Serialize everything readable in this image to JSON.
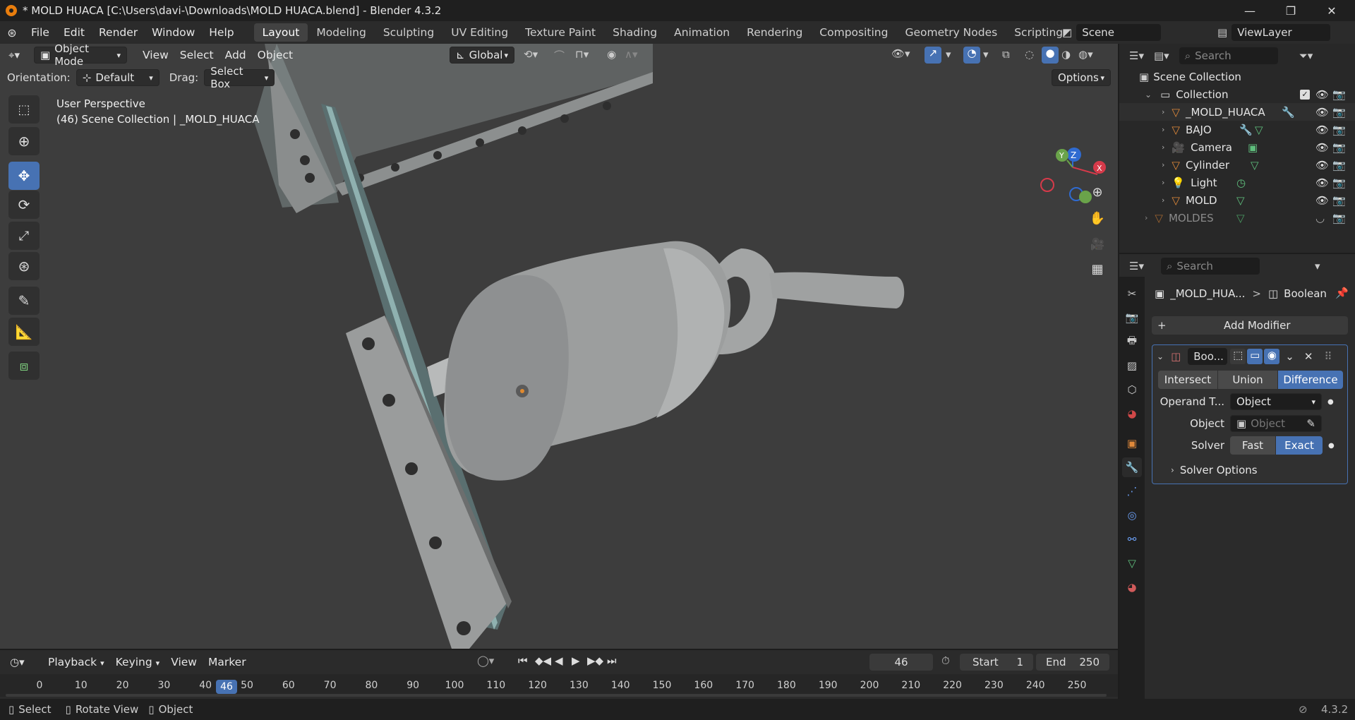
{
  "window": {
    "title": "* MOLD HUACA [C:\\Users\\davi-\\Downloads\\MOLD HUACA.blend] - Blender 4.3.2"
  },
  "menu": [
    "File",
    "Edit",
    "Render",
    "Window",
    "Help"
  ],
  "workspaces": [
    "Layout",
    "Modeling",
    "Sculpting",
    "UV Editing",
    "Texture Paint",
    "Shading",
    "Animation",
    "Rendering",
    "Compositing",
    "Geometry Nodes",
    "Scripting"
  ],
  "scene": {
    "name": "Scene",
    "view_layer": "ViewLayer"
  },
  "viewport": {
    "mode": "Object Mode",
    "menus": [
      "View",
      "Select",
      "Add",
      "Object"
    ],
    "transform_orientation": "Global",
    "orientation_label": "Orientation:",
    "orientation_value": "Default",
    "drag_label": "Drag:",
    "drag_value": "Select Box",
    "options_label": "Options",
    "overlay_line1": "User Perspective",
    "overlay_line2": "(46) Scene Collection | _MOLD_HUACA",
    "gizmo": {
      "x": "X",
      "y": "Y",
      "z": "Z"
    }
  },
  "outliner": {
    "search_placeholder": "Search",
    "root": "Scene Collection",
    "collection": "Collection",
    "items": [
      "_MOLD_HUACA",
      "BAJO",
      "Camera",
      "Cylinder",
      "Light",
      "MOLD"
    ],
    "other_collection": "MOLDES"
  },
  "properties": {
    "search_placeholder": "Search",
    "breadcrumb_object": "_MOLD_HUA...",
    "breadcrumb_sep": ">",
    "breadcrumb_modifier": "Boolean",
    "add_modifier": "Add Modifier",
    "modifier_name": "Boo...",
    "operations": [
      "Intersect",
      "Union",
      "Difference"
    ],
    "active_operation": "Difference",
    "operand_label": "Operand T...",
    "operand_value": "Object",
    "object_label": "Object",
    "object_placeholder": "Object",
    "solver_label": "Solver",
    "solvers": [
      "Fast",
      "Exact"
    ],
    "active_solver": "Exact",
    "solver_options": "Solver Options"
  },
  "timeline": {
    "menus": [
      "Playback",
      "Keying",
      "View",
      "Marker"
    ],
    "current_frame": "46",
    "start_label": "Start",
    "start_value": "1",
    "end_label": "End",
    "end_value": "250",
    "ticks": [
      "0",
      "10",
      "20",
      "30",
      "40",
      "50",
      "60",
      "70",
      "80",
      "90",
      "100",
      "110",
      "120",
      "130",
      "140",
      "150",
      "160",
      "170",
      "180",
      "190",
      "200",
      "210",
      "220",
      "230",
      "240",
      "250"
    ]
  },
  "status": {
    "select": "Select",
    "rotate": "Rotate View",
    "object": "Object",
    "version": "4.3.2"
  },
  "colors": {
    "accent": "#4772b3",
    "viewport_bg": "#3d3d3d",
    "object_orange": "#e0893a",
    "mesh_green": "#5fbf7d",
    "active_tab": "#4772b3"
  }
}
